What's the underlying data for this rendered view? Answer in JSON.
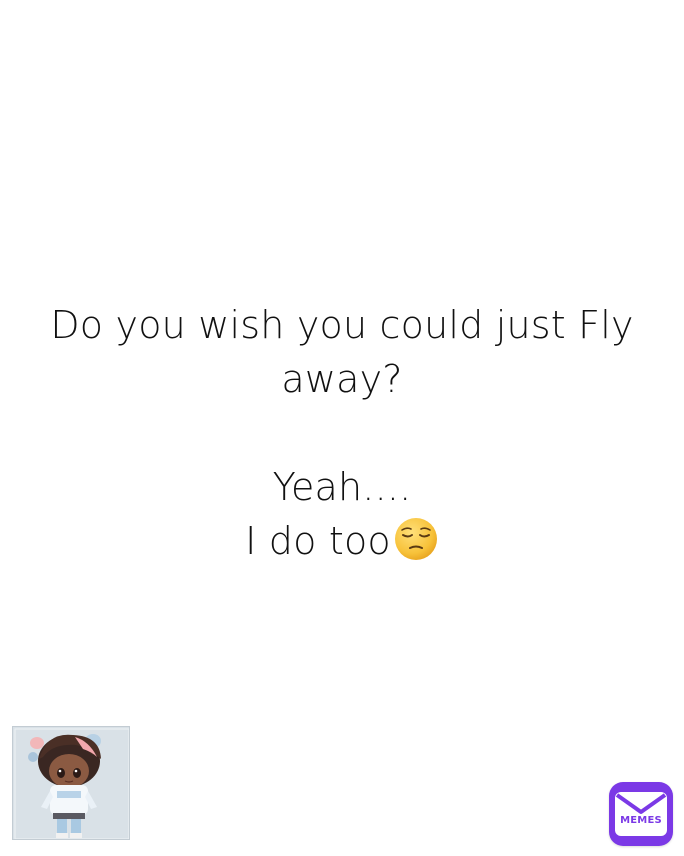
{
  "meme": {
    "line1": "Do you wish you could just Fly",
    "line2": "away?",
    "line3": "Yeah....",
    "line4": "I do too"
  },
  "emoji_icon": "pensive-face-icon",
  "avatar_icon": "chibi-character-avatar",
  "logo": {
    "label": "MEMES",
    "color": "#7b39e6"
  }
}
